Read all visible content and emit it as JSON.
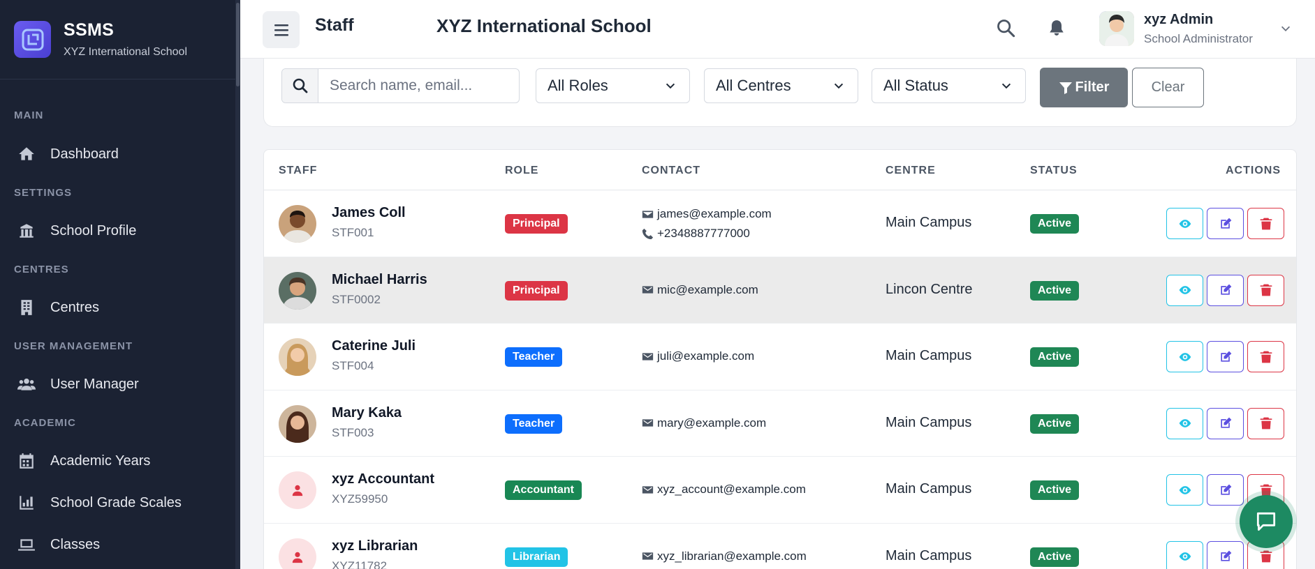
{
  "brand": {
    "name": "SSMS",
    "subtitle": "XYZ International School"
  },
  "sidebar": {
    "sections": [
      {
        "title": "MAIN",
        "items": [
          {
            "label": "Dashboard",
            "icon": "home-icon"
          }
        ]
      },
      {
        "title": "SETTINGS",
        "items": [
          {
            "label": "School Profile",
            "icon": "school-icon"
          }
        ]
      },
      {
        "title": "CENTRES",
        "items": [
          {
            "label": "Centres",
            "icon": "building-icon"
          }
        ]
      },
      {
        "title": "USER MANAGEMENT",
        "items": [
          {
            "label": "User Manager",
            "icon": "users-icon"
          }
        ]
      },
      {
        "title": "ACADEMIC",
        "items": [
          {
            "label": "Academic Years",
            "icon": "calendar-icon"
          },
          {
            "label": "School Grade Scales",
            "icon": "chart-icon"
          },
          {
            "label": "Classes",
            "icon": "laptop-icon"
          }
        ]
      }
    ]
  },
  "header": {
    "page_title": "Staff",
    "school_title": "XYZ International School",
    "user_name": "xyz Admin",
    "user_role": "School Administrator"
  },
  "filters": {
    "search_placeholder": "Search name, email...",
    "roles_selected": "All Roles",
    "centres_selected": "All Centres",
    "status_selected": "All Status",
    "filter_label": "Filter",
    "clear_label": "Clear"
  },
  "table": {
    "columns": [
      "STAFF",
      "ROLE",
      "CONTACT",
      "CENTRE",
      "STATUS",
      "ACTIONS"
    ],
    "rows": [
      {
        "name": "James Coll",
        "id": "STF001",
        "role": "Principal",
        "role_color": "#dc3545",
        "email": "james@example.com",
        "phone": "+2348887777000",
        "centre": "Main Campus",
        "status": "Active"
      },
      {
        "name": "Michael Harris",
        "id": "STF0002",
        "role": "Principal",
        "role_color": "#dc3545",
        "email": "mic@example.com",
        "phone": "",
        "centre": "Lincon Centre",
        "status": "Active"
      },
      {
        "name": "Caterine Juli",
        "id": "STF004",
        "role": "Teacher",
        "role_color": "#0d6efd",
        "email": "juli@example.com",
        "phone": "",
        "centre": "Main Campus",
        "status": "Active"
      },
      {
        "name": "Mary Kaka",
        "id": "STF003",
        "role": "Teacher",
        "role_color": "#0d6efd",
        "email": "mary@example.com",
        "phone": "",
        "centre": "Main Campus",
        "status": "Active"
      },
      {
        "name": "xyz Accountant",
        "id": "XYZ59950",
        "role": "Accountant",
        "role_color": "#198754",
        "email": "xyz_account@example.com",
        "phone": "",
        "centre": "Main Campus",
        "status": "Active"
      },
      {
        "name": "xyz Librarian",
        "id": "XYZ11782",
        "role": "Librarian",
        "role_color": "#22c3e6",
        "email": "xyz_librarian@example.com",
        "phone": "",
        "centre": "Main Campus",
        "status": "Active"
      }
    ]
  },
  "colors": {
    "sidebar_bg": "#1b2233",
    "accent": "#5b4fe0",
    "active_status": "#1f8755",
    "chat_fab": "#1d8a62"
  }
}
